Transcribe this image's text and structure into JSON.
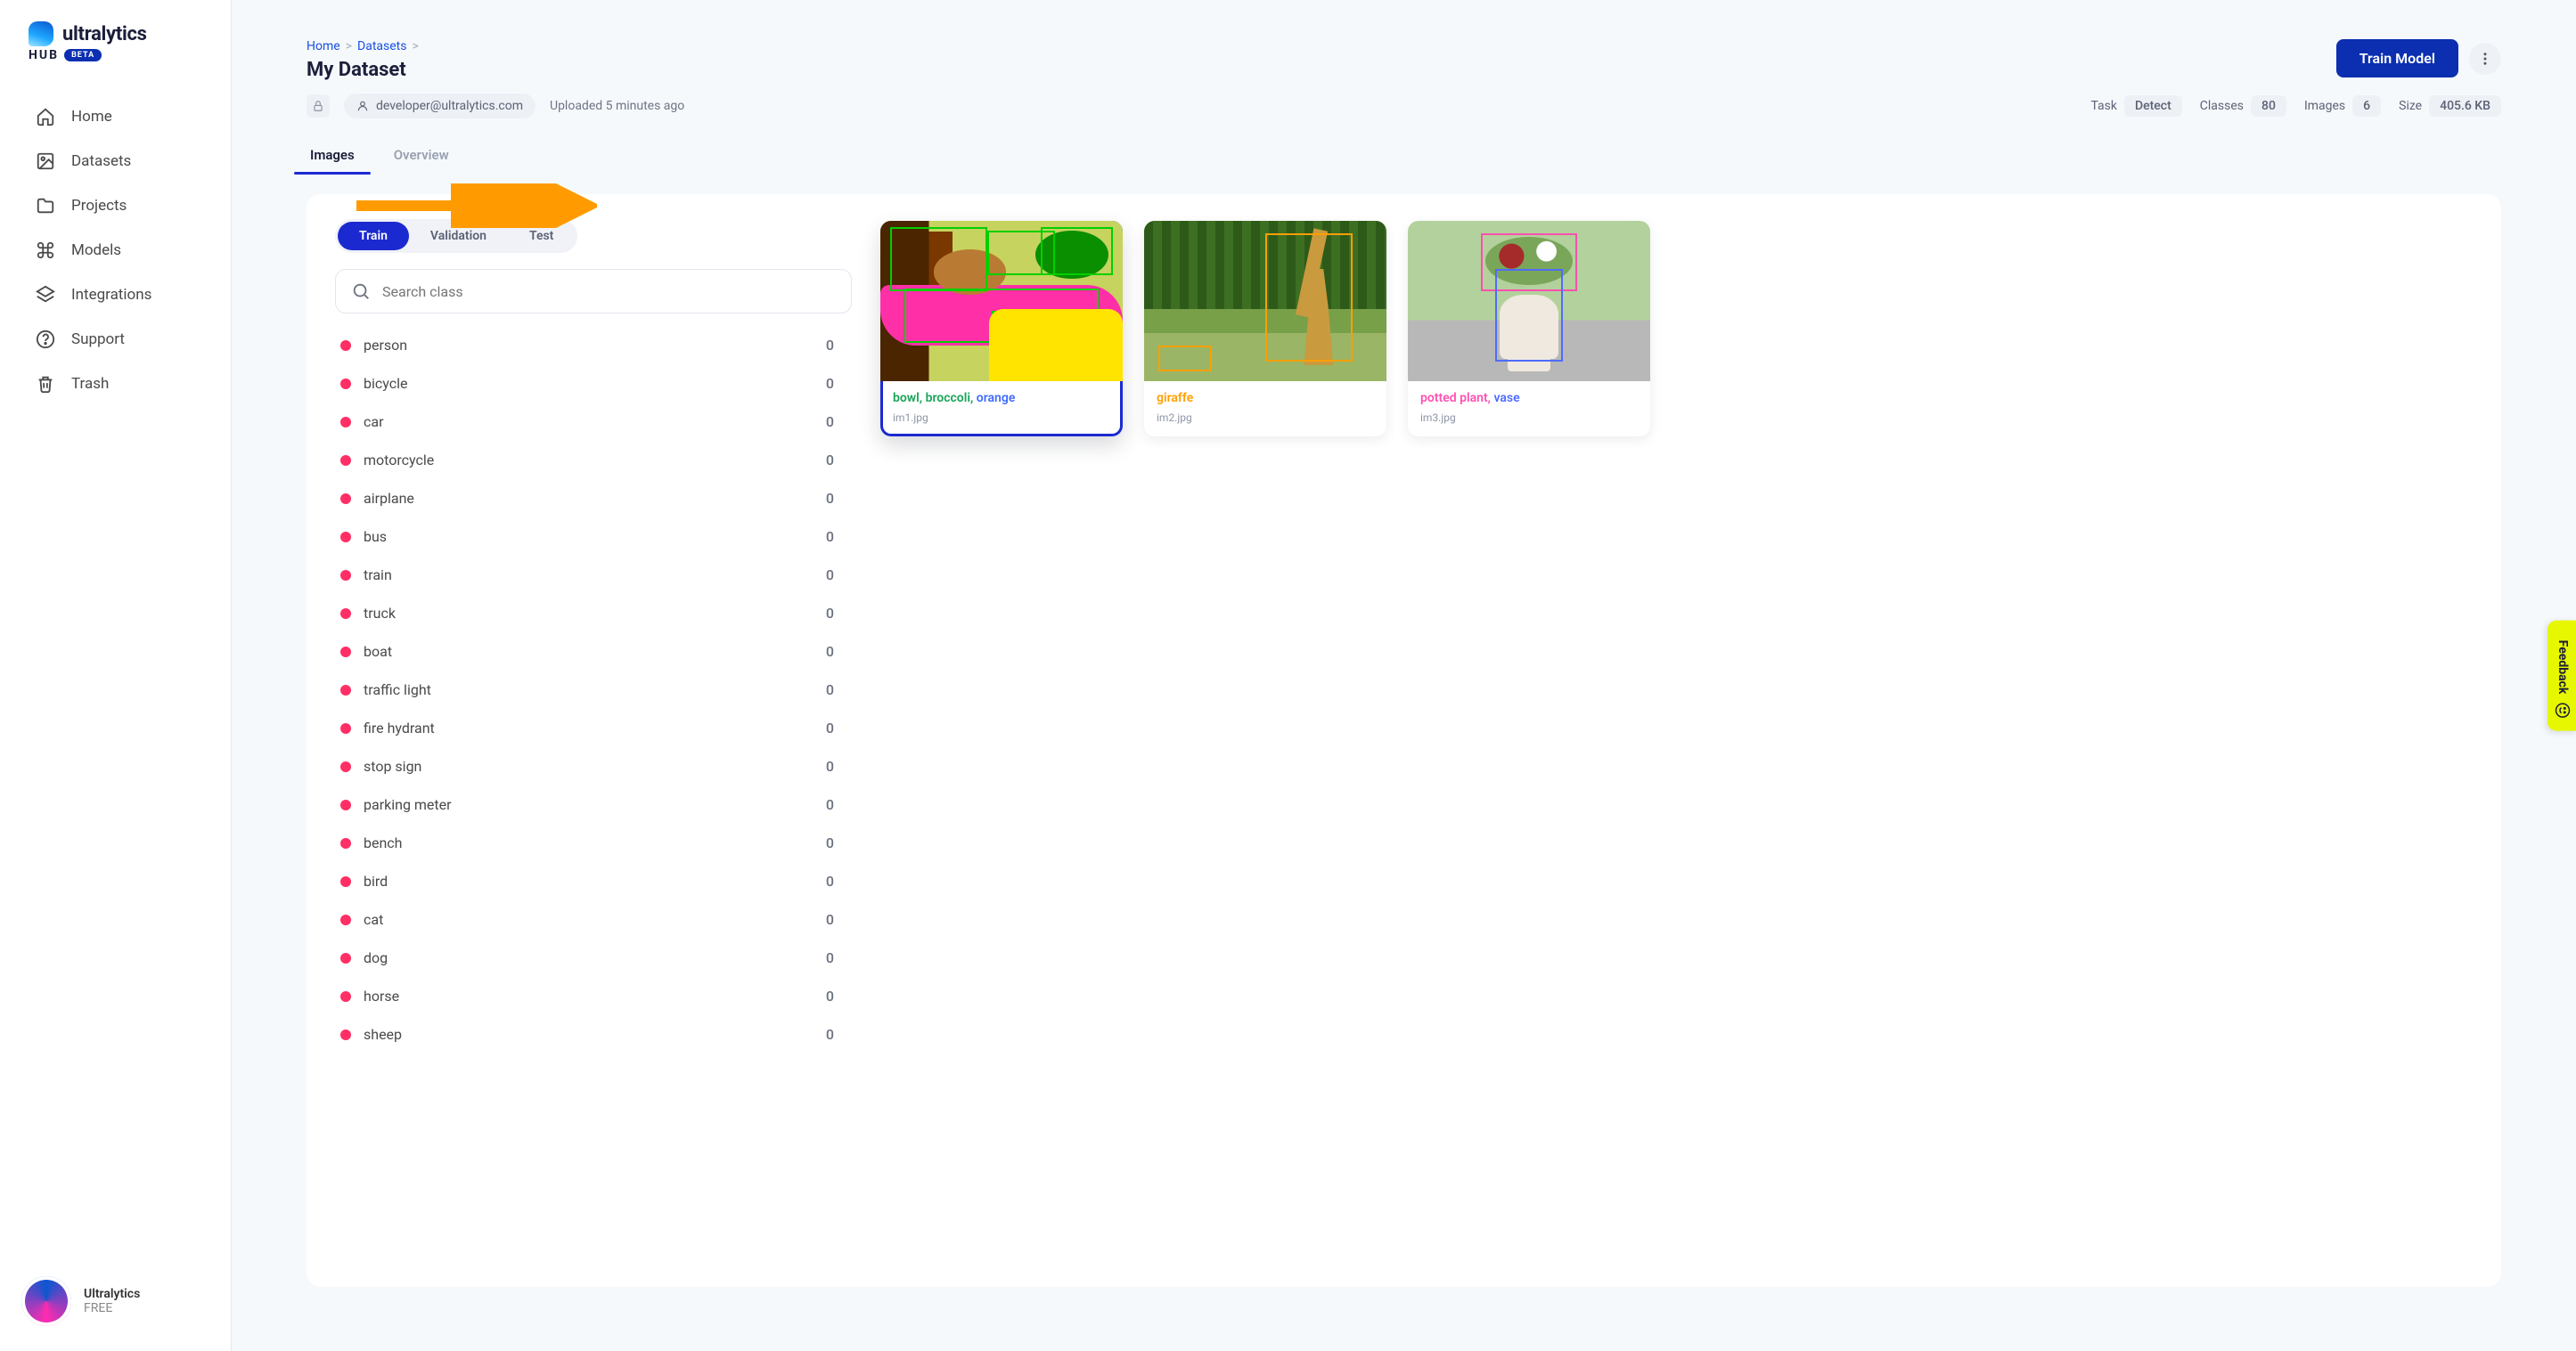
{
  "brand": {
    "name": "ultralytics",
    "hub": "HUB",
    "beta": "BETA"
  },
  "sidebar": {
    "items": [
      {
        "label": "Home"
      },
      {
        "label": "Datasets"
      },
      {
        "label": "Projects"
      },
      {
        "label": "Models"
      },
      {
        "label": "Integrations"
      },
      {
        "label": "Support"
      },
      {
        "label": "Trash"
      }
    ]
  },
  "account": {
    "name": "Ultralytics",
    "tier": "FREE"
  },
  "breadcrumbs": {
    "home": "Home",
    "datasets": "Datasets",
    "sep": ">"
  },
  "page": {
    "title": "My Dataset"
  },
  "header": {
    "train_button": "Train Model"
  },
  "meta": {
    "owner": "developer@ultralytics.com",
    "uploaded": "Uploaded 5 minutes ago",
    "task_label": "Task",
    "task_value": "Detect",
    "classes_label": "Classes",
    "classes_value": "80",
    "images_label": "Images",
    "images_value": "6",
    "size_label": "Size",
    "size_value": "405.6 KB"
  },
  "tabs": {
    "images": "Images",
    "overview": "Overview"
  },
  "split": {
    "train": "Train",
    "validation": "Validation",
    "test": "Test"
  },
  "search": {
    "placeholder": "Search class"
  },
  "classes": [
    {
      "name": "person",
      "count": "0"
    },
    {
      "name": "bicycle",
      "count": "0"
    },
    {
      "name": "car",
      "count": "0"
    },
    {
      "name": "motorcycle",
      "count": "0"
    },
    {
      "name": "airplane",
      "count": "0"
    },
    {
      "name": "bus",
      "count": "0"
    },
    {
      "name": "train",
      "count": "0"
    },
    {
      "name": "truck",
      "count": "0"
    },
    {
      "name": "boat",
      "count": "0"
    },
    {
      "name": "traffic light",
      "count": "0"
    },
    {
      "name": "fire hydrant",
      "count": "0"
    },
    {
      "name": "stop sign",
      "count": "0"
    },
    {
      "name": "parking meter",
      "count": "0"
    },
    {
      "name": "bench",
      "count": "0"
    },
    {
      "name": "bird",
      "count": "0"
    },
    {
      "name": "cat",
      "count": "0"
    },
    {
      "name": "dog",
      "count": "0"
    },
    {
      "name": "horse",
      "count": "0"
    },
    {
      "name": "sheep",
      "count": "0"
    }
  ],
  "gallery": [
    {
      "filename": "im1.jpg",
      "tags": [
        {
          "text": "bowl",
          "color": "#18a558"
        },
        {
          "text": "broccoli",
          "color": "#18a558"
        },
        {
          "text": "orange",
          "color": "#3f6bff"
        }
      ]
    },
    {
      "filename": "im2.jpg",
      "tags": [
        {
          "text": "giraffe",
          "color": "#ff9f00"
        }
      ]
    },
    {
      "filename": "im3.jpg",
      "tags": [
        {
          "text": "potted plant",
          "color": "#ff4fb0"
        },
        {
          "text": "vase",
          "color": "#4f6bff"
        }
      ]
    }
  ],
  "feedback": {
    "label": "Feedback"
  },
  "colors": {
    "accent": "#0b2fb0",
    "class_dot": "#ff2f65",
    "arrow": "#ff9b00"
  }
}
